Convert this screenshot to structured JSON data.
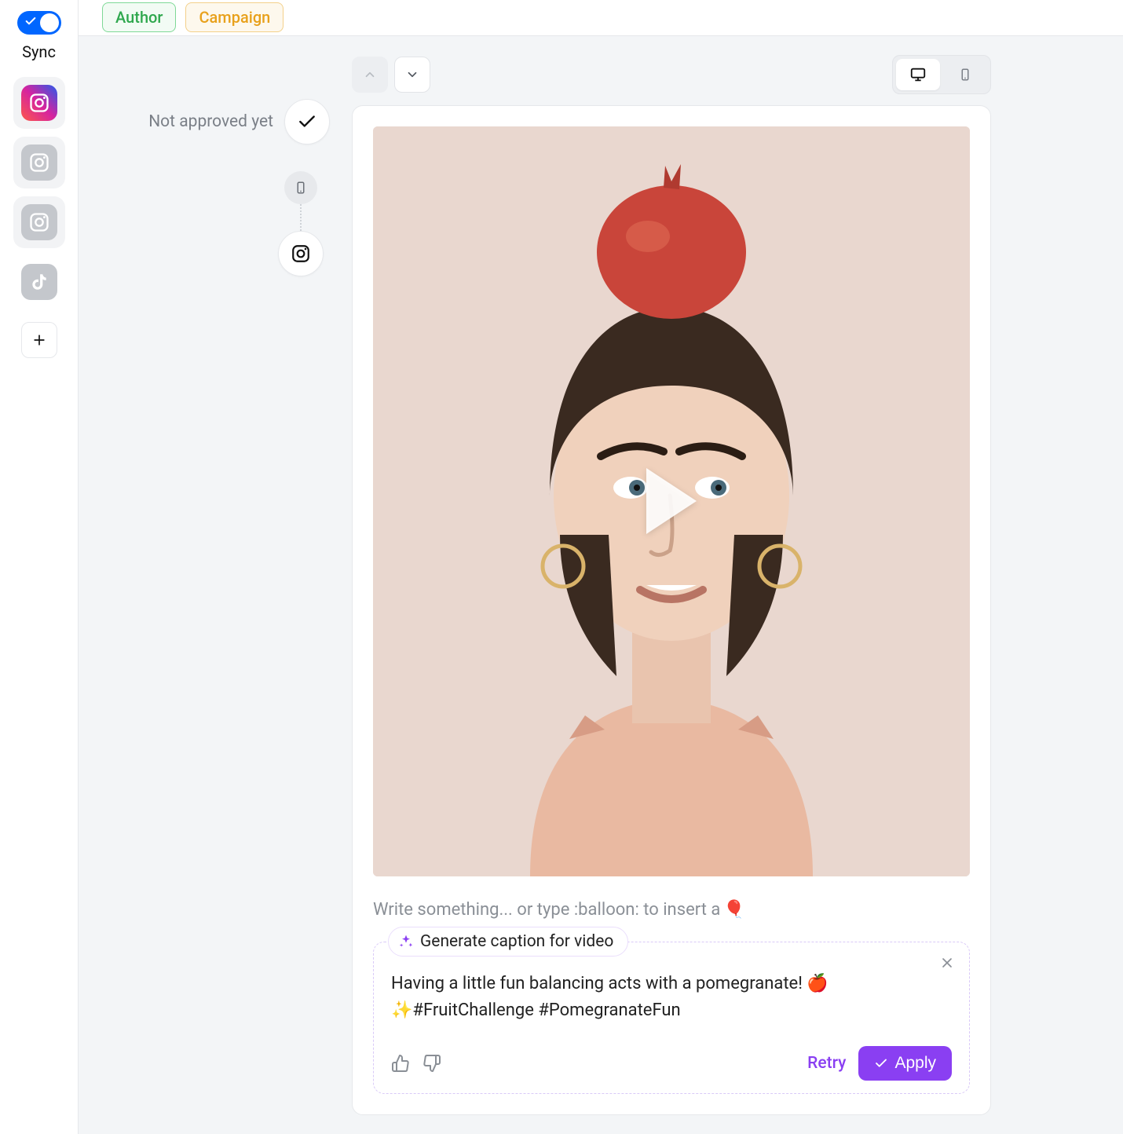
{
  "rail": {
    "sync_label": "Sync",
    "sync_on": true,
    "channels": [
      {
        "type": "instagram",
        "active": true
      },
      {
        "type": "instagram",
        "active": false
      },
      {
        "type": "instagram",
        "active": false
      },
      {
        "type": "tiktok",
        "active": false
      }
    ]
  },
  "tags": {
    "author": "Author",
    "campaign": "Campaign"
  },
  "status": {
    "text": "Not approved yet"
  },
  "caption": {
    "placeholder_prefix": "Write something... or type :balloon: to insert a ",
    "placeholder_emoji": "🎈"
  },
  "ai": {
    "tab_label": "Generate caption for video",
    "suggestion": "Having a little fun balancing acts with a pomegranate! 🍎✨#FruitChallenge #PomegranateFun",
    "retry_label": "Retry",
    "apply_label": "Apply"
  }
}
